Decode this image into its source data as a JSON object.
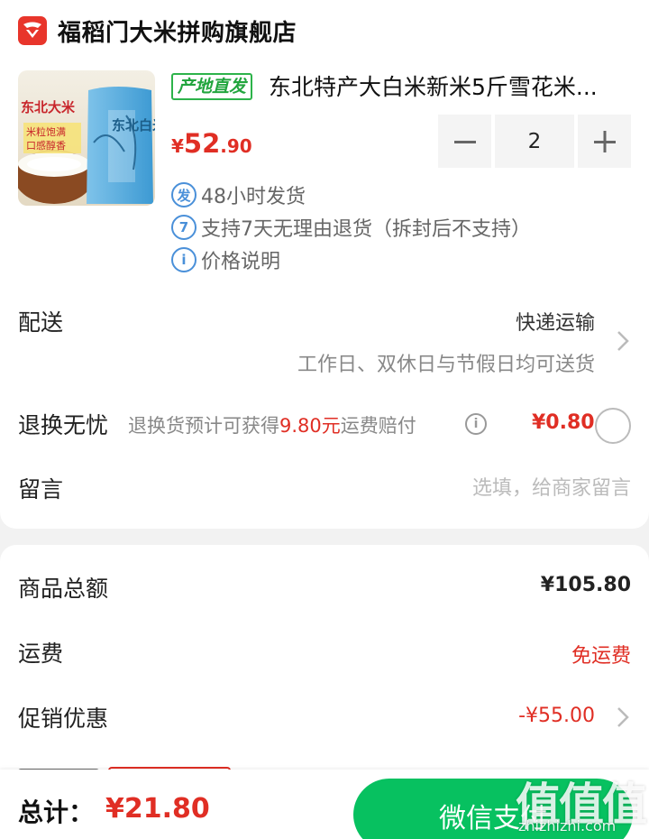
{
  "store": {
    "name": "福稻门大米拼购旗舰店",
    "logo_icon": "store-logo-icon",
    "brand_color": "#e8352b"
  },
  "product": {
    "badge": "产地直发",
    "title": "东北特产大白米新米5斤雪花米...",
    "price_currency": "¥",
    "price_int": "52",
    "price_dec": ".90",
    "image_text": {
      "left_banner": "东北大米",
      "sub1": "米粒饱满",
      "sub2": "口感醇香",
      "bag_text": "东北白米"
    },
    "quantity": "2",
    "services": [
      {
        "icon": "发",
        "text": "48小时发货"
      },
      {
        "icon": "7",
        "text": "支持7天无理由退货（拆封后不支持）"
      },
      {
        "icon": "i",
        "text": "价格说明"
      }
    ]
  },
  "shipping": {
    "label": "配送",
    "method": "快递运输",
    "note": "工作日、双休日与节假日均可送货"
  },
  "returns": {
    "label": "退换无忧",
    "desc_prefix": "退换货预计可获得",
    "desc_amount": "9.80元",
    "desc_suffix": "运费赔付",
    "price": "¥0.80",
    "selected": false
  },
  "message": {
    "label": "留言",
    "placeholder": "选填，给商家留言",
    "value": ""
  },
  "summary": {
    "subtotal_label": "商品总额",
    "subtotal_value": "¥105.80",
    "freight_label": "运费",
    "freight_value": "免运费",
    "promo_label": "促销优惠",
    "promo_value": "-¥55.00"
  },
  "footer": {
    "total_label": "总计：",
    "total_value": "¥21.80",
    "pay_label": "微信支付"
  },
  "watermark": {
    "glyphs": "值值值",
    "url": "zhizhizhi.com"
  },
  "colors": {
    "accent_red": "#e02e24",
    "wechat_green": "#07c160",
    "origin_green": "#22a53e",
    "info_blue": "#4a90d9"
  }
}
